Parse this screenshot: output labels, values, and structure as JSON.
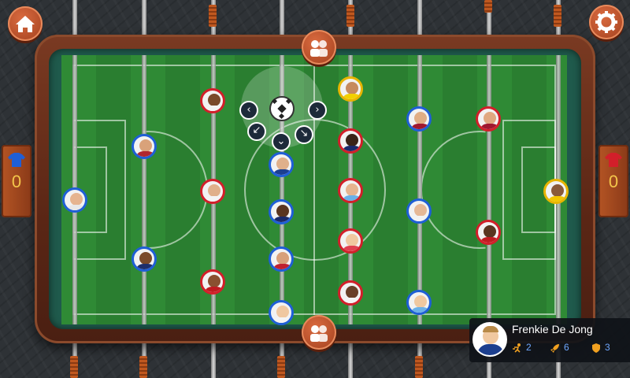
{
  "scores": {
    "left": "0",
    "right": "0"
  },
  "selected_player": {
    "name": "Frenkie De Jong",
    "stats": [
      {
        "icon": "running-speed-icon",
        "value": "2"
      },
      {
        "icon": "rocket-shot-icon",
        "value": "6"
      },
      {
        "icon": "shield-defense-icon",
        "value": "3"
      }
    ]
  },
  "colors": {
    "team_left": "#1f5fd6",
    "team_right": "#d21f2a",
    "goalkeeper_right": "#e8b400",
    "accent": "#f4c64a"
  },
  "buttons": {
    "home": "home-icon",
    "settings": "gear-icon",
    "swap_top": "swap-players-icon",
    "swap_bottom": "swap-players-icon"
  }
}
